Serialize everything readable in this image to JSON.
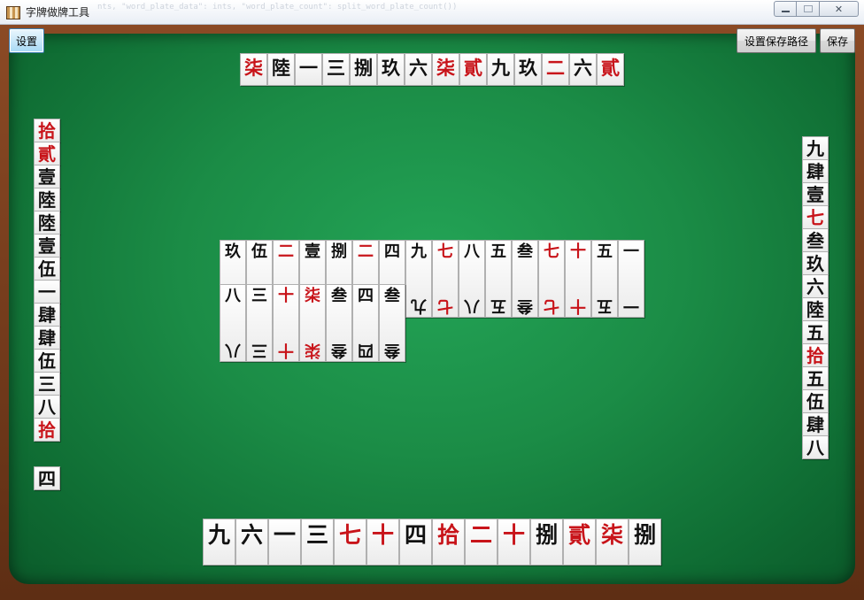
{
  "window": {
    "title": "字牌做牌工具",
    "background_code": "nts, \"word_plate_data\": ints, \"word_plate_count\": split_word_plate_count()) "
  },
  "toolbar": {
    "settings_label": "设置",
    "set_save_path_label": "设置保存路径",
    "save_label": "保存"
  },
  "colors": {
    "red_tile": "#c8141a",
    "black_tile": "#111111",
    "felt": "#1b8c46",
    "frame": "#6b3a1f"
  },
  "hands": {
    "top": [
      {
        "c": "柒",
        "red": true
      },
      {
        "c": "陸",
        "red": false
      },
      {
        "c": "一",
        "red": false
      },
      {
        "c": "三",
        "red": false
      },
      {
        "c": "捌",
        "red": false
      },
      {
        "c": "玖",
        "red": false
      },
      {
        "c": "六",
        "red": false
      },
      {
        "c": "柒",
        "red": true
      },
      {
        "c": "貳",
        "red": true
      },
      {
        "c": "九",
        "red": false
      },
      {
        "c": "玖",
        "red": false
      },
      {
        "c": "二",
        "red": true
      },
      {
        "c": "六",
        "red": false
      },
      {
        "c": "貳",
        "red": true
      }
    ],
    "left": [
      {
        "c": "拾",
        "red": true
      },
      {
        "c": "貳",
        "red": true
      },
      {
        "c": "壹",
        "red": false
      },
      {
        "c": "陸",
        "red": false
      },
      {
        "c": "陸",
        "red": false
      },
      {
        "c": "壹",
        "red": false
      },
      {
        "c": "伍",
        "red": false
      },
      {
        "c": "一",
        "red": false
      },
      {
        "c": "肆",
        "red": false
      },
      {
        "c": "肆",
        "red": false
      },
      {
        "c": "伍",
        "red": false
      },
      {
        "c": "三",
        "red": false
      },
      {
        "c": "八",
        "red": false
      },
      {
        "c": "拾",
        "red": true
      }
    ],
    "left_extra": [
      {
        "c": "四",
        "red": false
      }
    ],
    "right": [
      {
        "c": "九",
        "red": false
      },
      {
        "c": "肆",
        "red": false
      },
      {
        "c": "壹",
        "red": false
      },
      {
        "c": "七",
        "red": true
      },
      {
        "c": "叁",
        "red": false
      },
      {
        "c": "玖",
        "red": false
      },
      {
        "c": "六",
        "red": false
      },
      {
        "c": "陸",
        "red": false
      },
      {
        "c": "五",
        "red": false
      },
      {
        "c": "拾",
        "red": true
      },
      {
        "c": "五",
        "red": false
      },
      {
        "c": "伍",
        "red": false
      },
      {
        "c": "肆",
        "red": false
      },
      {
        "c": "八",
        "red": false
      }
    ],
    "bottom": [
      {
        "c": "九",
        "red": false
      },
      {
        "c": "六",
        "red": false
      },
      {
        "c": "一",
        "red": false
      },
      {
        "c": "三",
        "red": false
      },
      {
        "c": "七",
        "red": true
      },
      {
        "c": "十",
        "red": true
      },
      {
        "c": "四",
        "red": false
      },
      {
        "c": "拾",
        "red": true
      },
      {
        "c": "二",
        "red": true
      },
      {
        "c": "十",
        "red": true
      },
      {
        "c": "捌",
        "red": false
      },
      {
        "c": "貳",
        "red": true
      },
      {
        "c": "柒",
        "red": true
      },
      {
        "c": "捌",
        "red": false
      }
    ]
  },
  "center": {
    "row1": [
      {
        "c": "玖",
        "red": false
      },
      {
        "c": "伍",
        "red": false
      },
      {
        "c": "二",
        "red": true
      },
      {
        "c": "壹",
        "red": false
      },
      {
        "c": "捌",
        "red": false
      },
      {
        "c": "二",
        "red": true
      },
      {
        "c": "四",
        "red": false
      },
      {
        "c": "九",
        "red": false
      },
      {
        "c": "七",
        "red": true
      },
      {
        "c": "八",
        "red": false
      },
      {
        "c": "五",
        "red": false
      },
      {
        "c": "叁",
        "red": false
      },
      {
        "c": "七",
        "red": true
      },
      {
        "c": "十",
        "red": true
      },
      {
        "c": "五",
        "red": false
      },
      {
        "c": "一",
        "red": false
      }
    ],
    "row2": [
      {
        "c": "八",
        "red": false
      },
      {
        "c": "三",
        "red": false
      },
      {
        "c": "十",
        "red": true
      },
      {
        "c": "柒",
        "red": true
      },
      {
        "c": "叁",
        "red": false
      },
      {
        "c": "四",
        "red": false
      },
      {
        "c": "叁",
        "red": false
      }
    ]
  }
}
